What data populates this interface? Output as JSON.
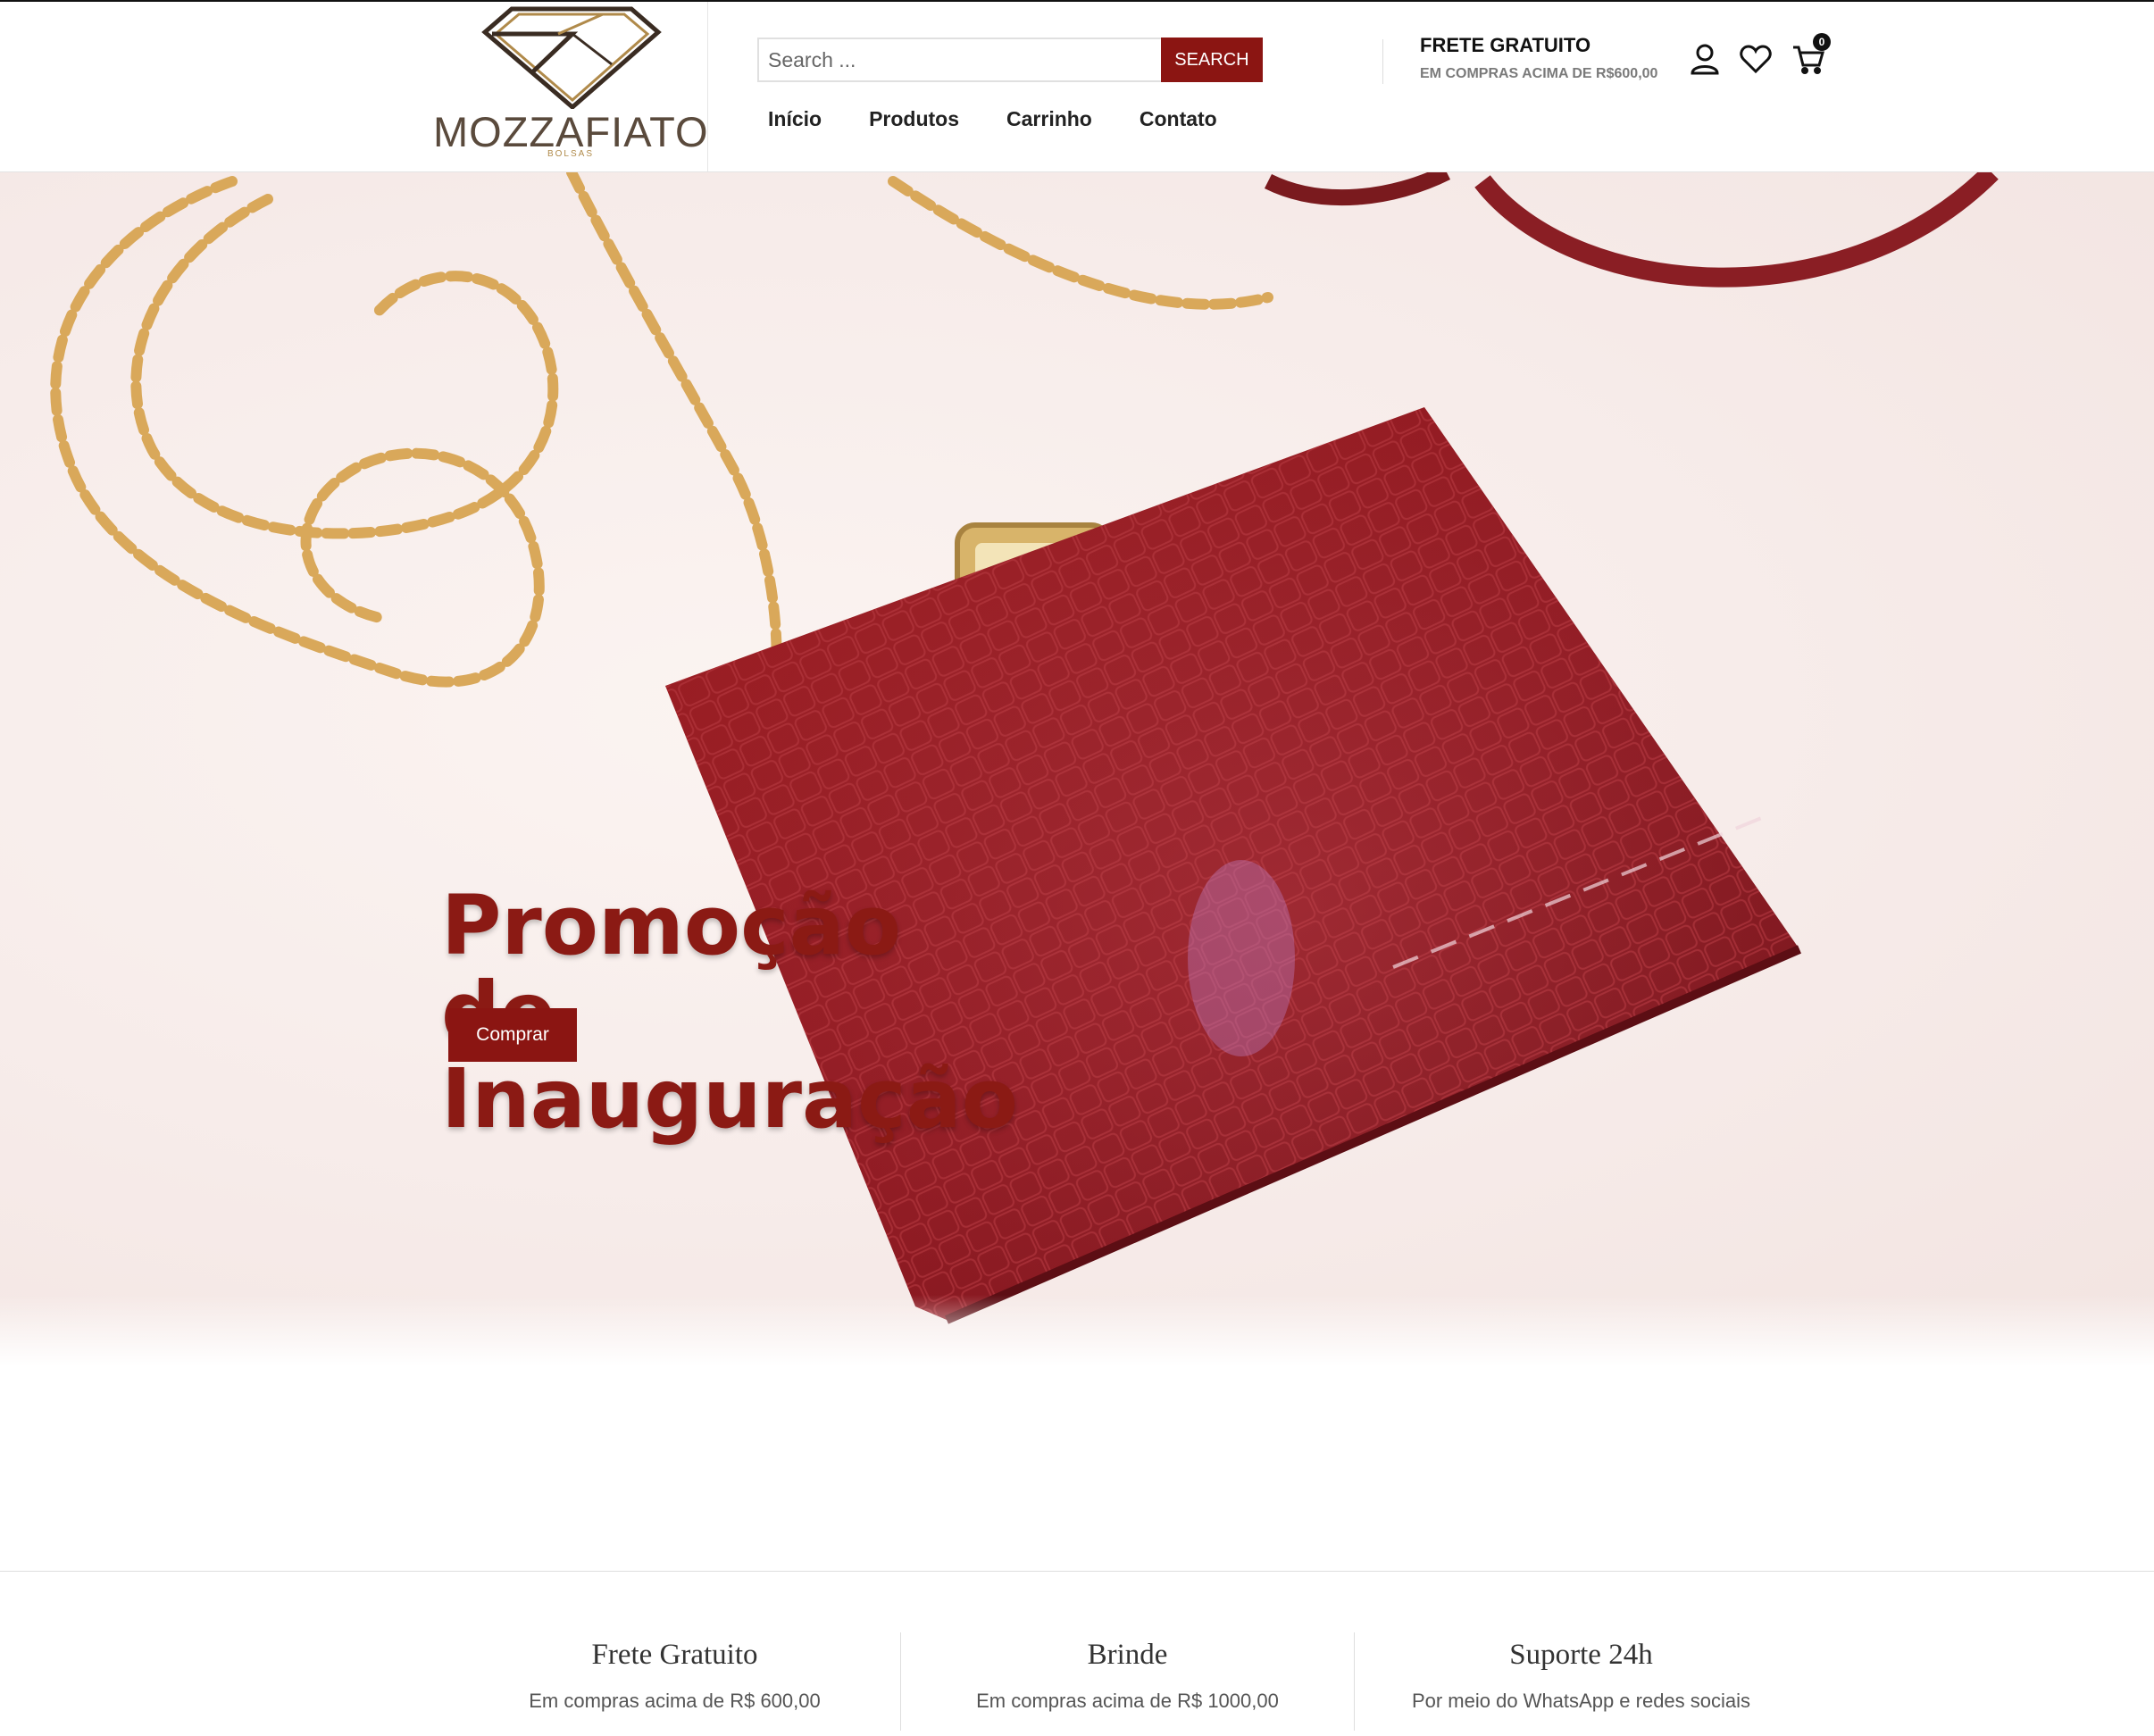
{
  "header": {
    "logo_text": "MOZZAFIATO",
    "logo_sub": "BOLSAS",
    "search": {
      "placeholder": "Search ...",
      "button_label": "SEARCH"
    },
    "nav": [
      "Início",
      "Produtos",
      "Carrinho",
      "Contato"
    ],
    "shipping": {
      "title": "FRETE GRATUITO",
      "subtitle": "EM COMPRAS ACIMA DE R$600,00"
    },
    "icons": [
      "user-icon",
      "heart-icon",
      "cart-icon"
    ],
    "cart_count": "0"
  },
  "hero": {
    "title_lines": [
      "Promoção",
      "de",
      "Inauguração"
    ],
    "button_label": "Comprar"
  },
  "features": [
    {
      "title": "Frete Gratuito",
      "text": "Em compras acima de R$ 600,00"
    },
    {
      "title": "Brinde",
      "text": "Em compras acima de R$ 1000,00"
    },
    {
      "title": "Suporte 24h",
      "text": "Por meio do WhatsApp e redes sociais"
    }
  ],
  "colors": {
    "brand": "#8b1512",
    "hero_title": "#8b1a14",
    "logo_gold": "#b08a4a"
  }
}
